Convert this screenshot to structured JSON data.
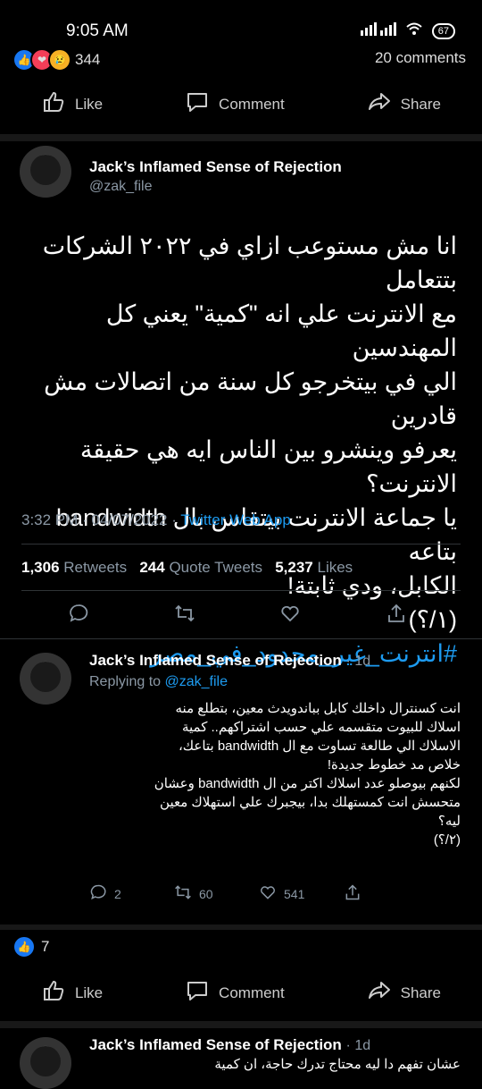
{
  "status": {
    "time": "9:05 AM",
    "battery": "67"
  },
  "post": {
    "reaction_count": "344",
    "comments_count": "20 comments",
    "actions": {
      "like": "Like",
      "comment": "Comment",
      "share": "Share"
    }
  },
  "tweet": {
    "author_name": "Jack’s Inflamed Sense of Rejection",
    "author_handle": "@zak_file",
    "lines": [
      "انا مش مستوعب ازاي في ٢٠٢٢ الشركات بتتعامل",
      "مع الانترنت علي انه \"كمية\" يعني كل المهندسين",
      "الي في بيتخرجو كل سنة من اتصالات مش قادرين",
      "يعرفو وينشرو بين الناس ايه هي حقيقة الانترنت؟",
      "يا جماعة الانترنت بيتقاس بال bandwidth بتاعه",
      "الكابل، ودي ثابتة!",
      "(١/؟)"
    ],
    "hashtag": "#انترنت_غير_محدود_في_مصر",
    "time": "3:32 PM · 04/07/2022 ·",
    "source": "Twitter Web App",
    "retweets": "1,306",
    "retweets_label": "Retweets",
    "quotes": "244",
    "quotes_label": "Quote Tweets",
    "likes": "5,237",
    "likes_label": "Likes"
  },
  "reply1": {
    "author_name": "Jack’s Inflamed Sense of Rejection",
    "age": "· 1d",
    "replying_prefix": "Replying to",
    "replying_handle": "@zak_file",
    "lines": [
      "انت كسنترال داخلك كابل بباندويدث معين، بتطلع منه",
      "اسلاك للبيوت متقسمه علي حسب اشتراكهم.. كمية",
      "الاسلاك الي طالعة تساوت مع ال bandwidth بتاعك،",
      "خلاص مد خطوط جديدة!",
      "لكنهم بيوصلو عدد اسلاك اكتر من ال bandwidth وعشان",
      "متحسش انت كمستهلك بدا، بيجبرك علي استهلاك معين",
      "ليه؟",
      "(٢/؟)"
    ],
    "replies": "2",
    "retweets": "60",
    "likes": "541"
  },
  "post2": {
    "reaction_count": "7",
    "actions": {
      "like": "Like",
      "comment": "Comment",
      "share": "Share"
    }
  },
  "reply2": {
    "author_name": "Jack’s Inflamed Sense of Rejection",
    "age": "· 1d",
    "line": "عشان تفهم دا ليه محتاج تدرك حاجة، ان كمية"
  }
}
